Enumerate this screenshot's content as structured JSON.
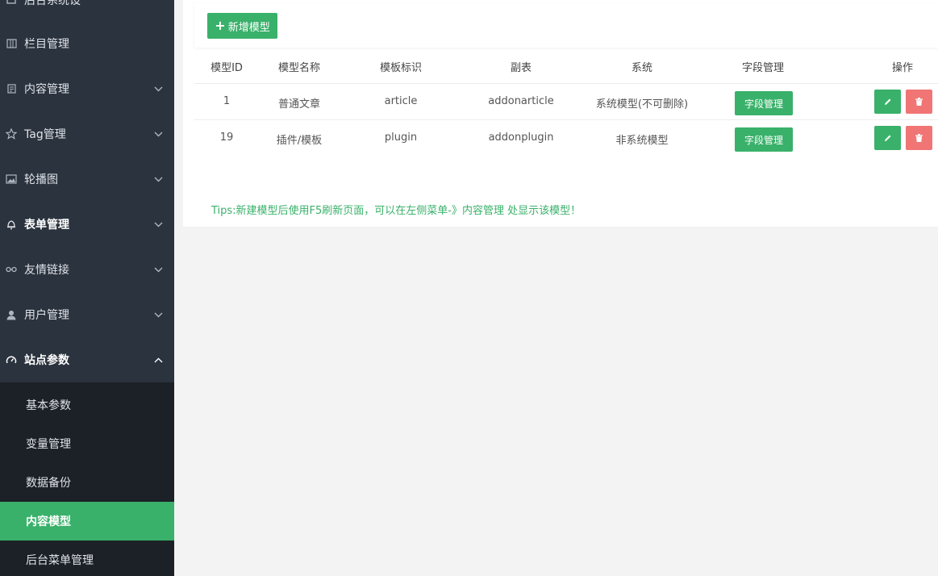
{
  "sidebar": {
    "top_partial_label": "后台系统设",
    "items": [
      {
        "label": "栏目管理",
        "icon": "columns-icon",
        "chevron": ""
      },
      {
        "label": "内容管理",
        "icon": "document-icon",
        "chevron": "down"
      },
      {
        "label": "Tag管理",
        "icon": "star-icon",
        "chevron": "down"
      },
      {
        "label": "轮播图",
        "icon": "image-icon",
        "chevron": "down"
      },
      {
        "label": "表单管理",
        "icon": "bell-icon",
        "chevron": "down"
      },
      {
        "label": "友情链接",
        "icon": "link-icon",
        "chevron": "down"
      },
      {
        "label": "用户管理",
        "icon": "user-icon",
        "chevron": "down"
      },
      {
        "label": "站点参数",
        "icon": "dashboard-icon",
        "chevron": "up"
      }
    ],
    "sub_items": [
      {
        "label": "基本参数",
        "active": false
      },
      {
        "label": "变量管理",
        "active": false
      },
      {
        "label": "数据备份",
        "active": false
      },
      {
        "label": "内容模型",
        "active": true
      },
      {
        "label": "后台菜单管理",
        "active": false
      }
    ],
    "colors": {
      "bg": "#2b333e",
      "sub_bg": "#1c2128",
      "active": "#39b16a"
    }
  },
  "toolbar": {
    "add_label": "新增模型"
  },
  "table": {
    "headers": [
      "模型ID",
      "模型名称",
      "模板标识",
      "副表",
      "系统",
      "字段管理",
      "操作"
    ],
    "rows": [
      {
        "id": "1",
        "name": "普通文章",
        "tag": "article",
        "sub_table": "addonarticle",
        "system": "系统模型(不可删除)",
        "field_btn": "字段管理"
      },
      {
        "id": "19",
        "name": "插件/模板",
        "tag": "plugin",
        "sub_table": "addonplugin",
        "system": "非系统模型",
        "field_btn": "字段管理"
      }
    ]
  },
  "tips": "Tips:新建模型后使用F5刷新页面，可以在左侧菜单-》内容管理 处显示该模型！",
  "colors": {
    "green": "#39b16a",
    "red": "#f07574"
  }
}
